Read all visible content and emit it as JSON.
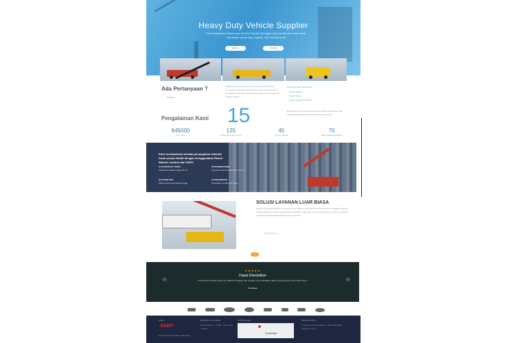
{
  "hero": {
    "title": "Heavy Duty Vehicle Supplier",
    "subtitle": "Kami Distributor Resmi dan Service Terbaik berbagai merk kendaraan berat untuk kebutuhan pelabuhan, logistik, dan industri Anda",
    "btn1": "DETAIL",
    "btn2": "KONTAK"
  },
  "question": {
    "title": "Ada Pertanyaan ?",
    "button": "Hubungi",
    "text": "Silahkan hubungi tim kami untuk informasi lebih lanjut mengenai produk dan layanan kami. Kami siap membantu kebutuhan kendaraan berat Anda dengan solusi terbaik dan harga bersaing."
  },
  "produk": {
    "heading": "PRODUK DARI SINI SAJA",
    "items": [
      "Reach Stacker",
      "Forklift Truck",
      "Empty Container Handler"
    ]
  },
  "experience": {
    "title": "Pengalaman Kami",
    "years": "15",
    "desc": "Berpengalaman lebih dari 15 tahun melayani kebutuhan alat berat pelabuhan dan industri di seluruh Indonesia",
    "stats": [
      {
        "num": "845000",
        "label": "Jam Kerja"
      },
      {
        "num": "125",
        "label": "Pelanggan Terpercaya"
      },
      {
        "num": "45",
        "label": "Proyek Selesai"
      },
      {
        "num": "70",
        "label": "Teknisi Berpengalaman"
      }
    ]
  },
  "reach": {
    "heading": "Kami menawarkan armada penanganan material Anda sesuai efektif dengan menggunakan Reach Stacker modern dari SANY",
    "features": [
      {
        "title": "01 KAPASITAS TINGGI",
        "text": "Kapasitas angkat hingga 45 ton"
      },
      {
        "title": "02 EFISIENSI BBM",
        "text": "Konsumsi bahan bakar lebih hemat"
      },
      {
        "title": "03 STABILITAS",
        "text": "Stabil untuk penumpukan tinggi"
      },
      {
        "title": "04 PERAWATAN",
        "text": "Perawatan mudah dan cepat"
      }
    ]
  },
  "solution": {
    "title": "SOLUSI LAYANAN LUAR BIASA",
    "text": "Kami menyediakan layanan purna jual yang lengkap mulai dari suku cadang asli, perawatan berkala, hingga perbaikan darurat oleh teknisi bersertifikat. Dukungan kami tersedia 24 jam untuk memastikan operasional Anda tetap berjalan tanpa hambatan.",
    "link": "Selengkapnya"
  },
  "testimonial": {
    "title": "Dapat Diandalkan",
    "stars": "★★★★★",
    "text": "\" Sewa Reach Stacker Sany tipe SRSC45 tangguh dan canggih, bisa diandalkan dalam pengoperasian dan performanya \"",
    "author": "Surabaya"
  },
  "footer": {
    "col1": "SANY",
    "brand": "SANY",
    "tagline": "PT Distributor Alat Berat Indonesia",
    "col2": "PRODUK & LAYANAN",
    "col2_items": "Reach Stacker · Forklift · Spare Part · Service",
    "col3": "LOKASI KAMI",
    "map_label": "Surabaya",
    "col4": "KONTAK KAMI",
    "col4_items": "Jl. Raya Industri Surabaya · (031) 000-0000 · info@sany.co.id"
  },
  "colors": {
    "accent": "#48a4d6",
    "dark": "#2c3a56",
    "orange": "#f5a623",
    "footer": "#1e2640"
  }
}
